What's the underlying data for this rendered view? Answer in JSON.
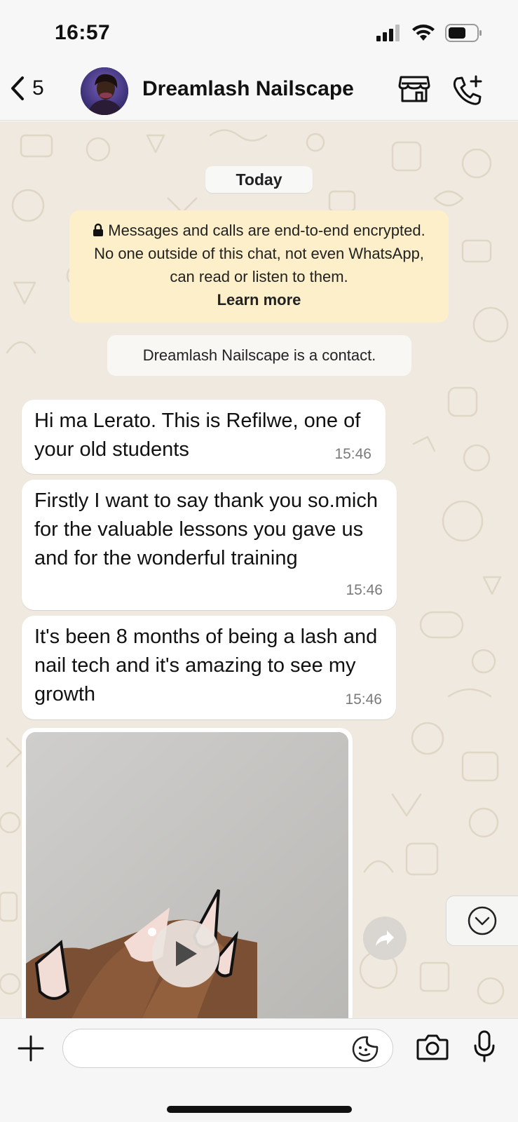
{
  "status_bar": {
    "time": "16:57"
  },
  "header": {
    "back_count": "5",
    "contact_name": "Dreamlash Nailscape"
  },
  "chat": {
    "date_label": "Today",
    "encryption_notice": {
      "text": "Messages and calls are end-to-end encrypted. No one outside of this chat, not even WhatsApp, can read or listen to them.",
      "link": "Learn more"
    },
    "contact_notice": "Dreamlash Nailscape is a contact.",
    "messages": [
      {
        "text": "Hi ma Lerato. This is Refilwe, one of your old students",
        "time": "15:46"
      },
      {
        "text": "Firstly I want to say thank you so.mich for the valuable lessons you gave us and for the wonderful training",
        "time": "15:46"
      },
      {
        "text": "It's been 8 months of being a lash and nail tech and it's amazing to see my growth",
        "time": "15:46"
      }
    ]
  },
  "composer": {
    "placeholder": ""
  },
  "colors": {
    "chat_background": "#efe9df",
    "encryption_background": "#fcefc9",
    "bubble_incoming": "#ffffff"
  }
}
